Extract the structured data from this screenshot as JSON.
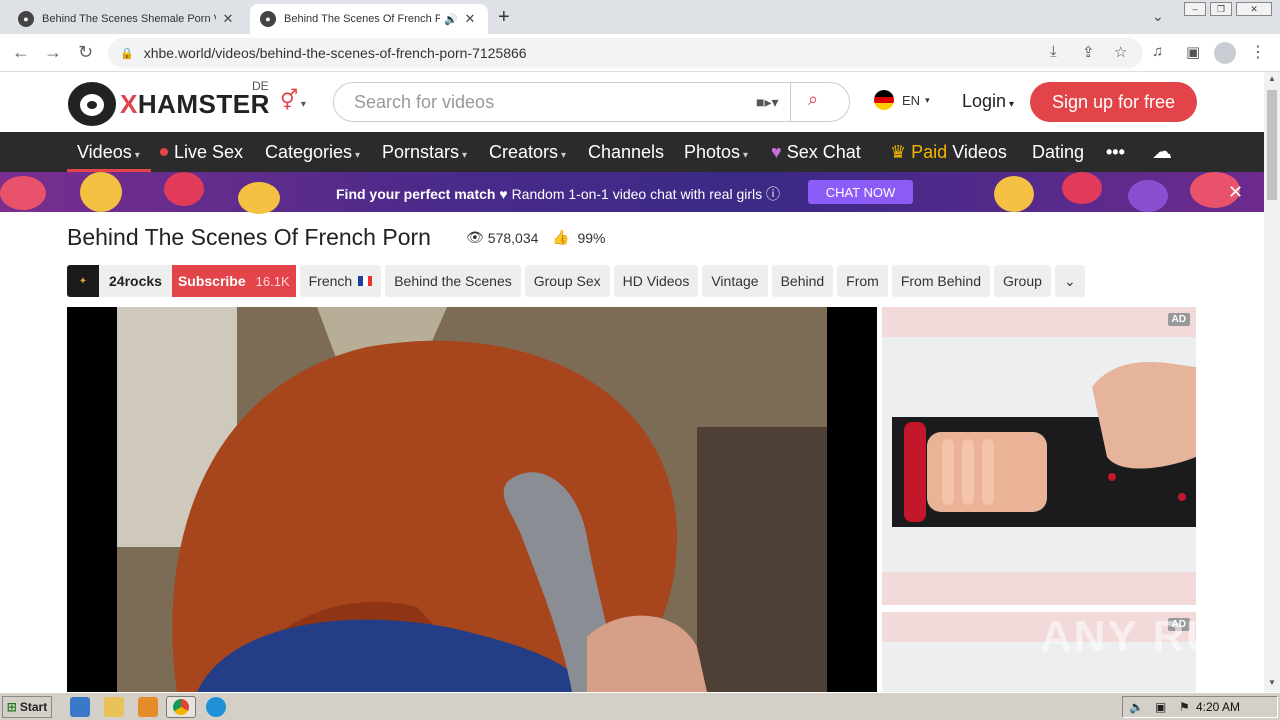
{
  "browser": {
    "tabs": [
      {
        "title": "Behind The Scenes Shemale Porn Vid",
        "active": false
      },
      {
        "title": "Behind The Scenes Of French P",
        "active": true
      }
    ],
    "url": "xhbe.world/videos/behind-the-scenes-of-french-porn-7125866"
  },
  "site": {
    "logo_x": "X",
    "logo_rest": "HAMSTER",
    "region": "DE",
    "search_placeholder": "Search for videos",
    "lang": "EN",
    "login": "Login",
    "signup": "Sign up for free"
  },
  "nav": {
    "items": [
      "Videos",
      "Live Sex",
      "Categories",
      "Pornstars",
      "Creators",
      "Channels",
      "Photos",
      "Sex Chat",
      "Paid",
      "Videos",
      "Dating",
      "•••"
    ]
  },
  "promo": {
    "bold": "Find your perfect match",
    "text": "Random 1-on-1 video chat with real girls",
    "cta": "CHAT NOW"
  },
  "video": {
    "title": "Behind The Scenes Of French Porn",
    "views": "578,034",
    "rating": "99%",
    "channel": "24rocks",
    "subscribe": "Subscribe",
    "subscribers": "16.1K",
    "tags": [
      "French",
      "Behind the Scenes",
      "Group Sex",
      "HD Videos",
      "Vintage",
      "Behind",
      "From",
      "From Behind",
      "Group"
    ]
  },
  "ads": {
    "badge": "AD"
  },
  "watermark": "ANY RUN",
  "taskbar": {
    "start": "Start",
    "clock": "4:20 AM"
  },
  "colors": {
    "brand": "#e34449",
    "nav_bg": "#2b2b2b",
    "cta": "#8b5cf6"
  }
}
